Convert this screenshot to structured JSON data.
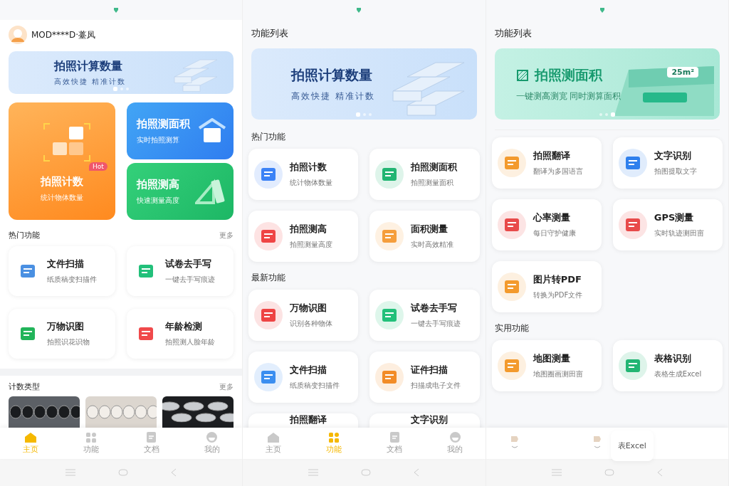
{
  "home": {
    "user_name": "MOD****D·薹凤",
    "banner": {
      "kind": "count",
      "title": "拍照计算数量",
      "subtitle": "高效快捷 精准计数",
      "dots": [
        {
          "selected": true
        },
        {
          "selected": false
        },
        {
          "selected": false
        }
      ]
    },
    "hero_cards": [
      {
        "kind": "count",
        "title": "拍照计数",
        "subtitle": "统计物体数量",
        "badge": "Hot"
      },
      {
        "kind": "area",
        "title": "拍照测面积",
        "subtitle": "实时拍照测算"
      },
      {
        "kind": "height",
        "title": "拍照测高",
        "subtitle": "快速测量高度"
      }
    ],
    "hot_section": {
      "title": "热门功能",
      "more": "更多",
      "items": [
        {
          "title": "文件扫描",
          "subtitle": "纸质稿变扫描件",
          "color": "#4a90e2"
        },
        {
          "title": "试卷去手写",
          "subtitle": "一键去手写痕迹",
          "color": "#22c07a"
        },
        {
          "title": "万物识图",
          "subtitle": "拍照识花识物",
          "color": "#22b45a"
        },
        {
          "title": "年龄检测",
          "subtitle": "拍照测人脸年龄",
          "color": "#f0494b"
        }
      ]
    },
    "types_section": {
      "title": "计数类型",
      "more": "更多"
    },
    "tabs": [
      {
        "kind": "home",
        "label": "主页",
        "selected": true
      },
      {
        "kind": "grid",
        "label": "功能",
        "selected": false
      },
      {
        "kind": "doc",
        "label": "文档",
        "selected": false
      },
      {
        "kind": "profile",
        "label": "我的",
        "selected": false
      }
    ]
  },
  "features": {
    "title": "功能列表",
    "banner": {
      "kind": "count",
      "title": "拍照计算数量",
      "subtitle": "高效快捷 精准计数",
      "dots": [
        {
          "selected": true
        },
        {
          "selected": false
        },
        {
          "selected": false
        }
      ]
    },
    "sections": [
      {
        "title": "热门功能",
        "items": [
          {
            "title": "拍照计数",
            "subtitle": "统计物体数量",
            "color": "#3b82f6"
          },
          {
            "title": "拍照测面积",
            "subtitle": "拍照测量面积",
            "color": "#22b573"
          },
          {
            "title": "拍照测高",
            "subtitle": "拍照测量高度",
            "color": "#ef4444"
          },
          {
            "title": "面积测量",
            "subtitle": "实时高效精准",
            "color": "#f59e3c"
          }
        ]
      },
      {
        "title": "最新功能",
        "items": [
          {
            "title": "万物识图",
            "subtitle": "识别各种物体",
            "color": "#ee4444"
          },
          {
            "title": "试卷去手写",
            "subtitle": "一键去手写痕迹",
            "color": "#22c07a"
          },
          {
            "title": "文件扫描",
            "subtitle": "纸质稿变扫描件",
            "color": "#3b8ef0"
          },
          {
            "title": "证件扫描",
            "subtitle": "扫描成电子文件",
            "color": "#f28c28"
          },
          {
            "kind": "cut",
            "title": "拍照翻译"
          },
          {
            "kind": "cut",
            "title": "文字识别"
          }
        ]
      }
    ],
    "tabs": [
      {
        "kind": "home",
        "label": "主页",
        "selected": false
      },
      {
        "kind": "grid",
        "label": "功能",
        "selected": true
      },
      {
        "kind": "doc",
        "label": "文档",
        "selected": false
      },
      {
        "kind": "profile",
        "label": "我的",
        "selected": false
      }
    ]
  },
  "features_scrolled": {
    "title": "功能列表",
    "banner": {
      "kind": "area",
      "title": "拍照测面积",
      "subtitle": "一键测高测宽 同时测算面积",
      "badge": "25m²",
      "dots": [
        {
          "selected": false
        },
        {
          "selected": false
        },
        {
          "selected": true
        }
      ]
    },
    "sections": [
      {
        "items": [
          {
            "title": "拍照翻译",
            "subtitle": "翻译为多国语言",
            "color": "#f39a2d"
          },
          {
            "title": "文字识别",
            "subtitle": "拍图提取文字",
            "color": "#2f80ed"
          },
          {
            "title": "心率测量",
            "subtitle": "每日守护健康",
            "color": "#e84a4a"
          },
          {
            "title": "GPS测量",
            "subtitle": "实时轨迹测田亩",
            "color": "#e84a4a"
          },
          {
            "title": "图片转PDF",
            "subtitle": "转换为PDF文件",
            "color": "#f39a2d"
          }
        ]
      },
      {
        "title": "实用功能",
        "items": [
          {
            "title": "地图测量",
            "subtitle": "地图圈画测田亩",
            "color": "#f39a2d"
          },
          {
            "title": "表格识别",
            "subtitle": "表格生成Excel",
            "color": "#22b573"
          }
        ]
      }
    ],
    "overlay_label": "表Excel"
  }
}
